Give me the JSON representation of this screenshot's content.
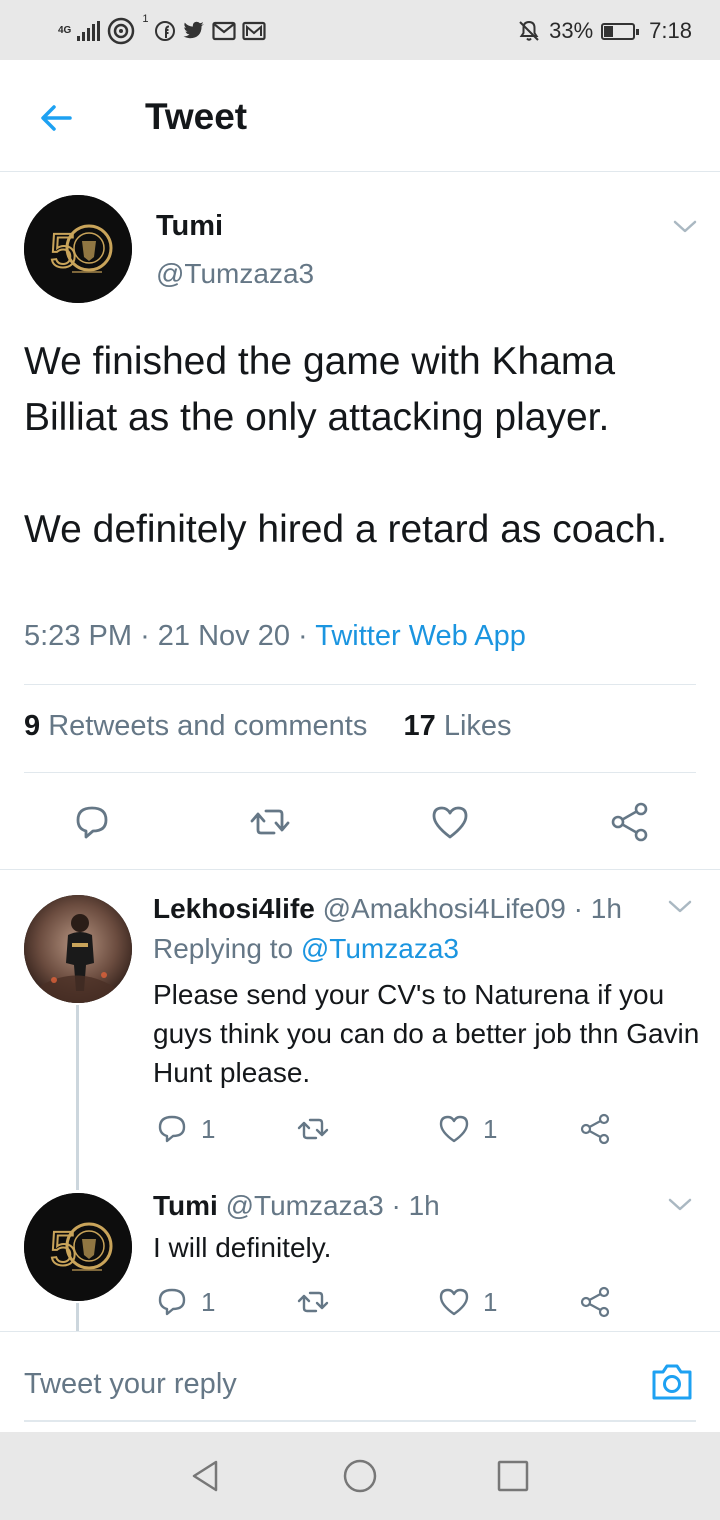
{
  "status_bar": {
    "network": "4G",
    "sim_indicator": "1",
    "icons": [
      "signal-icon",
      "hotspot-icon",
      "facebook-icon",
      "twitter-icon",
      "gmail-icon",
      "mail-icon"
    ],
    "battery": "33%",
    "battery_level": 0.33,
    "time": "7:18"
  },
  "header": {
    "title": "Tweet",
    "back_icon": "back-arrow-icon"
  },
  "main_tweet": {
    "name": "Tumi",
    "handle": "@Tumzaza3",
    "text_p1": "We finished the game with Khama Billiat as the only attacking player.",
    "text_p2": "We definitely hired a retard as coach.",
    "time": "5:23 PM",
    "date": "21 Nov 20",
    "app": "Twitter Web App",
    "retweets_count": "9",
    "retweets_label": "Retweets and comments",
    "likes_count": "17",
    "likes_label": "Likes"
  },
  "replies": [
    {
      "name": "Lekhosi4life",
      "handle": "@Amakhosi4Life09",
      "time": "· 1h",
      "replying_prefix": "Replying to",
      "replying_to": "@Tumzaza3",
      "text": "Please send your CV's to Naturena if you guys think you can do a better job thn Gavin Hunt please.",
      "comments": "1",
      "likes": "1"
    },
    {
      "name": "Tumi",
      "handle": "@Tumzaza3",
      "time": "· 1h",
      "text": "I will definitely.",
      "comments": "1",
      "likes": "1"
    }
  ],
  "reply_bar": {
    "placeholder": "Tweet your reply"
  },
  "colors": {
    "accent": "#1da1f2",
    "link": "#1b95e0",
    "secondary_text": "#657786",
    "divider": "#e1e8ed",
    "avatar_gold": "#c9a45a"
  }
}
